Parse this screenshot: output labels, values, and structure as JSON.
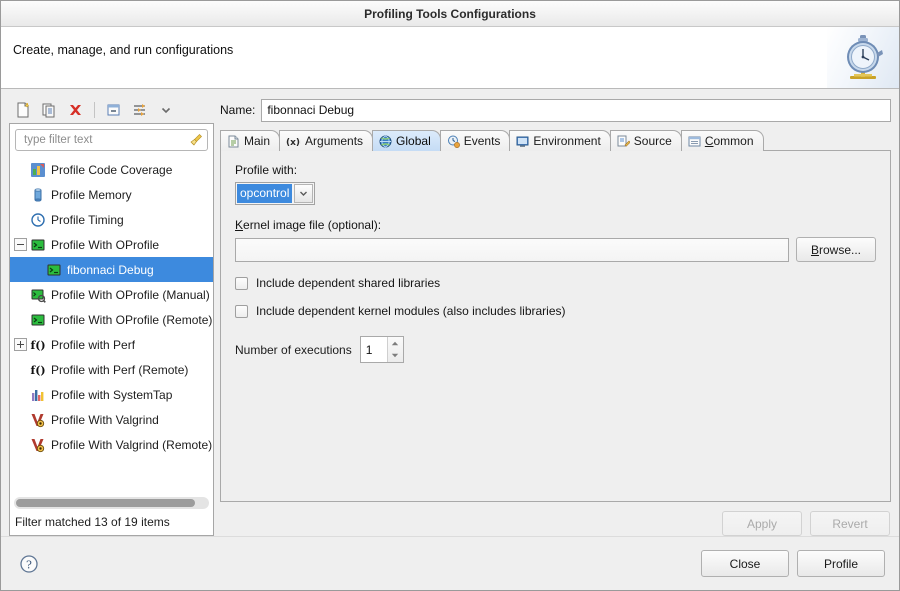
{
  "window": {
    "title": "Profiling Tools Configurations"
  },
  "header": {
    "text": "Create, manage, and run configurations",
    "icon": "stopwatch-icon"
  },
  "toolbar": {
    "buttons": [
      {
        "name": "new-configuration-button",
        "icon": "new-document-icon"
      },
      {
        "name": "duplicate-configuration-button",
        "icon": "copy-document-icon"
      },
      {
        "name": "delete-configuration-button",
        "icon": "delete-red-x-icon"
      },
      {
        "name": "collapse-all-button",
        "icon": "collapse-all-icon"
      },
      {
        "name": "filter-button",
        "icon": "filter-icon"
      },
      {
        "name": "view-menu-button",
        "icon": "chevron-down-icon"
      }
    ]
  },
  "filter": {
    "placeholder": "type filter text",
    "value": "",
    "clear_icon": "broom-icon",
    "status": "Filter matched 13 of 19 items"
  },
  "tree": {
    "items": [
      {
        "label": "Profile Code Coverage",
        "icon": "code-coverage-icon",
        "indent": 0,
        "twisty": "none",
        "selected": false
      },
      {
        "label": "Profile Memory",
        "icon": "memory-icon",
        "indent": 0,
        "twisty": "none",
        "selected": false
      },
      {
        "label": "Profile Timing",
        "icon": "timing-clock-icon",
        "indent": 0,
        "twisty": "none",
        "selected": false
      },
      {
        "label": "Profile With OProfile",
        "icon": "oprofile-icon",
        "indent": 0,
        "twisty": "minus",
        "selected": false
      },
      {
        "label": "fibonnaci Debug",
        "icon": "oprofile-config-icon",
        "indent": 1,
        "twisty": "none",
        "selected": true
      },
      {
        "label": "Profile With OProfile (Manual)",
        "icon": "oprofile-manual-icon",
        "indent": 0,
        "twisty": "none",
        "selected": false
      },
      {
        "label": "Profile With OProfile (Remote)",
        "icon": "oprofile-remote-icon",
        "indent": 0,
        "twisty": "none",
        "selected": false
      },
      {
        "label": "Profile with Perf",
        "icon": "perf-fx-icon",
        "indent": 0,
        "twisty": "plus",
        "selected": false
      },
      {
        "label": "Profile with Perf (Remote)",
        "icon": "perf-fx-icon",
        "indent": 0,
        "twisty": "none",
        "selected": false
      },
      {
        "label": "Profile with SystemTap",
        "icon": "systemtap-chart-icon",
        "indent": 0,
        "twisty": "none",
        "selected": false
      },
      {
        "label": "Profile With Valgrind",
        "icon": "valgrind-icon",
        "indent": 0,
        "twisty": "none",
        "selected": false
      },
      {
        "label": "Profile With Valgrind (Remote)",
        "icon": "valgrind-icon",
        "indent": 0,
        "twisty": "none",
        "selected": false
      }
    ]
  },
  "config": {
    "name_label": "Name:",
    "name_value": "fibonnaci Debug",
    "tabs": [
      {
        "label": "Main",
        "icon": "main-document-icon",
        "active": false
      },
      {
        "label": "Arguments",
        "icon": "arguments-icon",
        "active": false
      },
      {
        "label": "Global",
        "icon": "global-globe-icon",
        "active": true
      },
      {
        "label": "Events",
        "icon": "events-clock-icon",
        "active": false
      },
      {
        "label": "Environment",
        "icon": "environment-icon",
        "active": false
      },
      {
        "label": "Source",
        "icon": "source-icon",
        "active": false
      },
      {
        "label": "Common",
        "icon": "common-icon",
        "active": false
      }
    ],
    "global": {
      "profile_with_label": "Profile with:",
      "profile_with_value": "opcontrol",
      "kernel_image_label": "Kernel image file (optional):",
      "kernel_image_value": "",
      "browse_label": "Browse...",
      "checkbox_shared_libs": "Include dependent shared libraries",
      "checkbox_shared_libs_checked": false,
      "checkbox_kernel_modules": "Include dependent kernel modules (also includes libraries)",
      "checkbox_kernel_modules_checked": false,
      "executions_label": "Number of executions",
      "executions_value": "1"
    },
    "apply_label": "Apply",
    "revert_label": "Revert"
  },
  "footer": {
    "help_icon": "help-question-icon",
    "close_label": "Close",
    "profile_label": "Profile"
  },
  "colors": {
    "selection_blue": "#3d8ade",
    "tab_active": "#c5dcf5",
    "dialog_bg": "#efefef"
  }
}
